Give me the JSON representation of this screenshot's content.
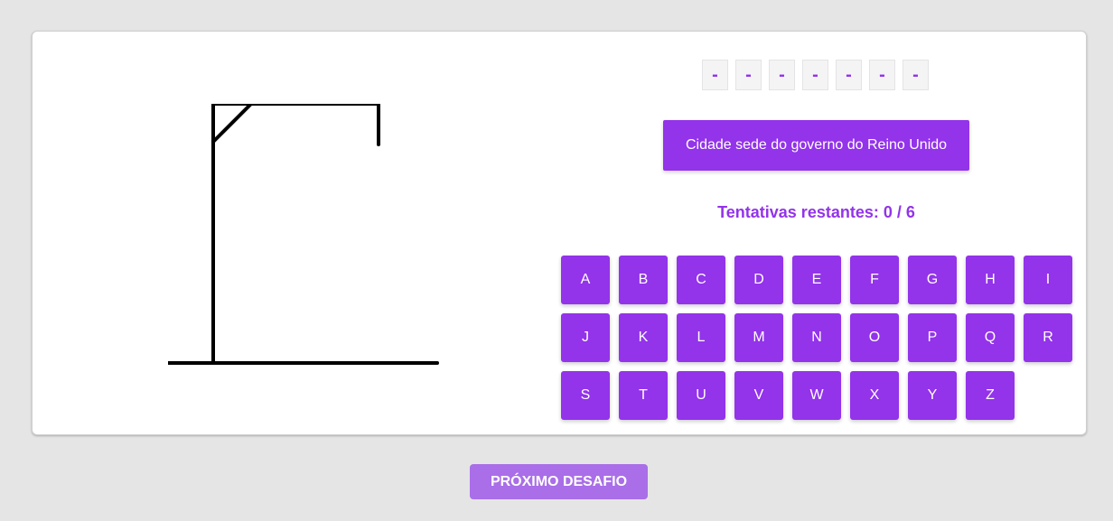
{
  "game": {
    "word_slots": [
      "-",
      "-",
      "-",
      "-",
      "-",
      "-",
      "-"
    ],
    "hint": "Cidade sede do governo do Reino Unido",
    "attempts_text": "Tentativas restantes: 0 / 6",
    "keyboard_letters": [
      "A",
      "B",
      "C",
      "D",
      "E",
      "F",
      "G",
      "H",
      "I",
      "J",
      "K",
      "L",
      "M",
      "N",
      "O",
      "P",
      "Q",
      "R",
      "S",
      "T",
      "U",
      "V",
      "W",
      "X",
      "Y",
      "Z"
    ],
    "next_button_label": "PRÓXIMO DESAFIO"
  },
  "colors": {
    "accent": "#9333ea",
    "next_button": "#a96ee8",
    "background": "#e5e5e5",
    "card": "#ffffff"
  }
}
